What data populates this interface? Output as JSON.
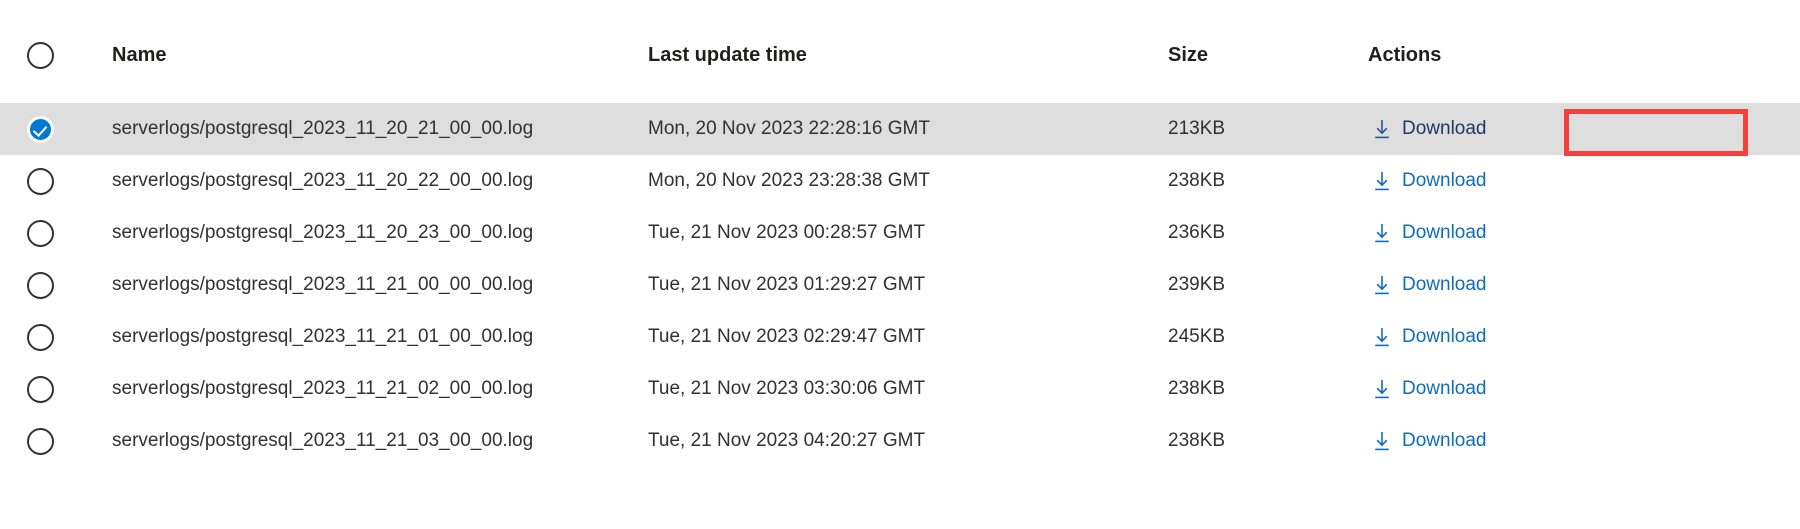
{
  "table": {
    "columns": {
      "select": "",
      "name": "Name",
      "last_update_time": "Last update time",
      "size": "Size",
      "actions": "Actions"
    },
    "header_checkbox_state": "unchecked",
    "rows": [
      {
        "selected": true,
        "checkbox_state": "checked",
        "name": "serverlogs/postgresql_2023_11_20_21_00_00.log",
        "last_update_time": "Mon, 20 Nov 2023 22:28:16 GMT",
        "size": "213KB",
        "action_label": "Download",
        "action_icon": "download-arrow-icon",
        "action_visited": true,
        "annotated": true
      },
      {
        "selected": false,
        "checkbox_state": "unchecked",
        "name": "serverlogs/postgresql_2023_11_20_22_00_00.log",
        "last_update_time": "Mon, 20 Nov 2023 23:28:38 GMT",
        "size": "238KB",
        "action_label": "Download",
        "action_icon": "download-arrow-icon",
        "action_visited": false,
        "annotated": false
      },
      {
        "selected": false,
        "checkbox_state": "unchecked",
        "name": "serverlogs/postgresql_2023_11_20_23_00_00.log",
        "last_update_time": "Tue, 21 Nov 2023 00:28:57 GMT",
        "size": "236KB",
        "action_label": "Download",
        "action_icon": "download-arrow-icon",
        "action_visited": false,
        "annotated": false
      },
      {
        "selected": false,
        "checkbox_state": "unchecked",
        "name": "serverlogs/postgresql_2023_11_21_00_00_00.log",
        "last_update_time": "Tue, 21 Nov 2023 01:29:27 GMT",
        "size": "239KB",
        "action_label": "Download",
        "action_icon": "download-arrow-icon",
        "action_visited": false,
        "annotated": false
      },
      {
        "selected": false,
        "checkbox_state": "unchecked",
        "name": "serverlogs/postgresql_2023_11_21_01_00_00.log",
        "last_update_time": "Tue, 21 Nov 2023 02:29:47 GMT",
        "size": "245KB",
        "action_label": "Download",
        "action_icon": "download-arrow-icon",
        "action_visited": false,
        "annotated": false
      },
      {
        "selected": false,
        "checkbox_state": "unchecked",
        "name": "serverlogs/postgresql_2023_11_21_02_00_00.log",
        "last_update_time": "Tue, 21 Nov 2023 03:30:06 GMT",
        "size": "238KB",
        "action_label": "Download",
        "action_icon": "download-arrow-icon",
        "action_visited": false,
        "annotated": false
      },
      {
        "selected": false,
        "checkbox_state": "unchecked",
        "name": "serverlogs/postgresql_2023_11_21_03_00_00.log",
        "last_update_time": "Tue, 21 Nov 2023 04:20:27 GMT",
        "size": "238KB",
        "action_label": "Download",
        "action_icon": "download-arrow-icon",
        "action_visited": false,
        "annotated": false
      }
    ]
  },
  "colors": {
    "selected_row_background": "#dedede",
    "link": "#0f6cbd",
    "visited_link": "#1f3864",
    "checkbox_checked": "#0078d4",
    "annotation_border": "#f8403a",
    "text": "#323130"
  }
}
